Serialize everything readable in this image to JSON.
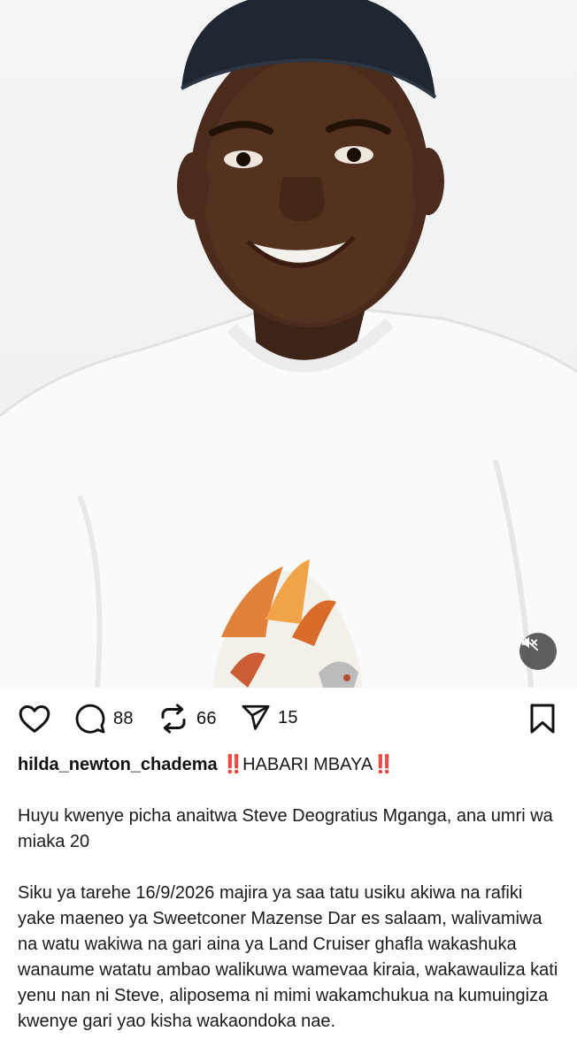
{
  "post": {
    "media": {
      "description_icon": "person-photo",
      "mute_icon": "speaker-muted-icon"
    },
    "actions": {
      "like_count": "",
      "comment_count": "88",
      "repost_count": "66",
      "share_count": "15"
    },
    "caption": {
      "username": "hilda_newton_chadema",
      "alert_emoji": "‼️",
      "headline": "HABARI MBAYA",
      "paragraph_1": "Huyu kwenye picha anaitwa Steve Deogratius Mganga, ana umri wa miaka 20",
      "paragraph_2": "Siku ya tarehe 16/9/2026 majira ya saa tatu usiku akiwa na rafiki yake maeneo ya Sweetconer Mazense Dar es salaam, walivamiwa na watu wakiwa na gari aina ya Land Cruiser ghafla wakashuka wanaume watatu ambao walikuwa wamevaa kiraia, wakawauliza kati yenu nan ni Steve, aliposema ni mimi wakamchukua na kumuingiza kwenye gari yao kisha wakaondoka nae."
    },
    "colors": {
      "accent_alert": "#e0162b",
      "icon": "#111111"
    }
  }
}
